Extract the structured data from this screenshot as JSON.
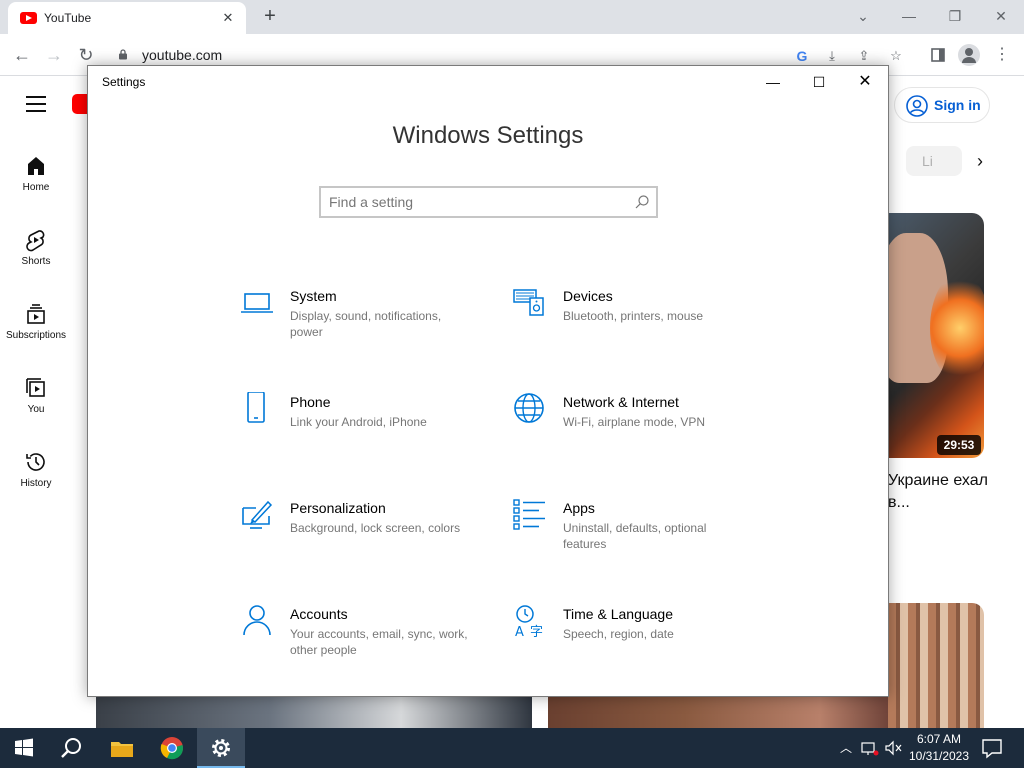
{
  "browser": {
    "tab_title": "YouTube",
    "tab_close": "✕",
    "new_tab": "+",
    "url": "youtube.com"
  },
  "youtube": {
    "sidebar": [
      {
        "label": "Home",
        "icon": "home-icon"
      },
      {
        "label": "Shorts",
        "icon": "shorts-icon"
      },
      {
        "label": "Subscriptions",
        "icon": "subscriptions-icon"
      },
      {
        "label": "You",
        "icon": "you-icon"
      },
      {
        "label": "History",
        "icon": "history-icon"
      }
    ],
    "sign_in": "Sign in",
    "chip_partial": "Li",
    "video": {
      "duration": "29:53",
      "title_partial": "Украине ехал в..."
    }
  },
  "settings": {
    "window_title": "Settings",
    "heading": "Windows Settings",
    "search_placeholder": "Find a setting",
    "categories": [
      {
        "title": "System",
        "desc": "Display, sound, notifications, power",
        "icon": "laptop-icon"
      },
      {
        "title": "Devices",
        "desc": "Bluetooth, printers, mouse",
        "icon": "devices-icon"
      },
      {
        "title": "Phone",
        "desc": "Link your Android, iPhone",
        "icon": "phone-icon"
      },
      {
        "title": "Network & Internet",
        "desc": "Wi-Fi, airplane mode, VPN",
        "icon": "globe-icon"
      },
      {
        "title": "Personalization",
        "desc": "Background, lock screen, colors",
        "icon": "personalization-icon"
      },
      {
        "title": "Apps",
        "desc": "Uninstall, defaults, optional features",
        "icon": "apps-icon"
      },
      {
        "title": "Accounts",
        "desc": "Your accounts, email, sync, work, other people",
        "icon": "accounts-icon"
      },
      {
        "title": "Time & Language",
        "desc": "Speech, region, date",
        "icon": "time-language-icon"
      }
    ],
    "accent_color": "#0078d7"
  },
  "taskbar": {
    "time": "6:07 AM",
    "date": "10/31/2023",
    "apps": [
      "start-icon",
      "search-icon",
      "file-explorer-icon",
      "chrome-icon",
      "settings-gear-icon"
    ]
  }
}
